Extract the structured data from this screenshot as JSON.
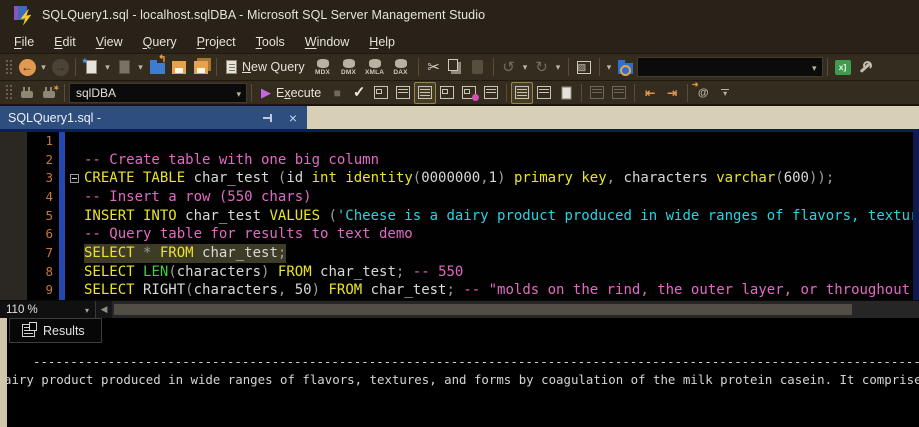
{
  "window": {
    "title": "SQLQuery1.sql - localhost.sqlDBA - Microsoft SQL Server Management Studio"
  },
  "menu": {
    "items": [
      {
        "label": "File",
        "u": 0
      },
      {
        "label": "Edit",
        "u": 0
      },
      {
        "label": "View",
        "u": 0
      },
      {
        "label": "Query",
        "u": 0
      },
      {
        "label": "Project",
        "u": 0
      },
      {
        "label": "Tools",
        "u": 0
      },
      {
        "label": "Window",
        "u": 0
      },
      {
        "label": "Help",
        "u": 0
      }
    ]
  },
  "toolbar_standard": {
    "new_query": {
      "label": "New Query",
      "u": 0
    },
    "query_type_buttons": [
      "MDX",
      "DMX",
      "XMLA",
      "DAX"
    ],
    "search_combo_value": ""
  },
  "toolbar_sql": {
    "database_combo_value": "sqlDBA",
    "execute": {
      "label": "Execute",
      "u": 1
    }
  },
  "document_tab": {
    "label": "SQLQuery1.sql -"
  },
  "editor": {
    "zoom_level": "110 %",
    "lines": [
      {
        "num": "1",
        "segments": []
      },
      {
        "num": "2",
        "segments": [
          {
            "c": "cm",
            "t": "-- Create table with one big column"
          }
        ]
      },
      {
        "num": "3",
        "fold": "minus",
        "segments": [
          {
            "c": "kw",
            "t": "CREATE TABLE"
          },
          {
            "c": "pl",
            "t": " char_test "
          },
          {
            "c": "gr",
            "t": "("
          },
          {
            "c": "pl",
            "t": "id "
          },
          {
            "c": "kw",
            "t": "int identity"
          },
          {
            "c": "gr",
            "t": "("
          },
          {
            "c": "pl",
            "t": "0000000"
          },
          {
            "c": "gr",
            "t": ","
          },
          {
            "c": "pl",
            "t": "1"
          },
          {
            "c": "gr",
            "t": ") "
          },
          {
            "c": "kw",
            "t": "primary key"
          },
          {
            "c": "gr",
            "t": ", "
          },
          {
            "c": "pl",
            "t": "characters "
          },
          {
            "c": "kw",
            "t": "varchar"
          },
          {
            "c": "gr",
            "t": "("
          },
          {
            "c": "pl",
            "t": "600"
          },
          {
            "c": "gr",
            "t": "));"
          }
        ]
      },
      {
        "num": "4",
        "segments": [
          {
            "c": "cm",
            "t": "-- Insert a row (550 chars)"
          }
        ]
      },
      {
        "num": "5",
        "segments": [
          {
            "c": "kw",
            "t": "INSERT INTO"
          },
          {
            "c": "pl",
            "t": " char_test "
          },
          {
            "c": "kw",
            "t": "VALUES"
          },
          {
            "c": "gr",
            "t": " ("
          },
          {
            "c": "str",
            "t": "'Cheese is a dairy product produced in wide ranges of flavors, textures, and"
          }
        ]
      },
      {
        "num": "6",
        "segments": [
          {
            "c": "cm",
            "t": "-- Query table for results to text demo"
          }
        ]
      },
      {
        "num": "7",
        "sel": true,
        "segments": [
          {
            "c": "kw",
            "t": "SELECT"
          },
          {
            "c": "gr",
            "t": " * "
          },
          {
            "c": "kw",
            "t": "FROM"
          },
          {
            "c": "pl",
            "t": " char_test"
          },
          {
            "c": "gr",
            "t": ";"
          }
        ]
      },
      {
        "num": "8",
        "segments": [
          {
            "c": "kw",
            "t": "SELECT"
          },
          {
            "c": "pl",
            "t": " "
          },
          {
            "c": "fn",
            "t": "LEN"
          },
          {
            "c": "gr",
            "t": "("
          },
          {
            "c": "pl",
            "t": "characters"
          },
          {
            "c": "gr",
            "t": ") "
          },
          {
            "c": "kw",
            "t": "FROM"
          },
          {
            "c": "pl",
            "t": " char_test"
          },
          {
            "c": "gr",
            "t": "; "
          },
          {
            "c": "cm",
            "t": "-- 550"
          }
        ]
      },
      {
        "num": "9",
        "segments": [
          {
            "c": "kw",
            "t": "SELECT"
          },
          {
            "c": "pl",
            "t": " RIGHT"
          },
          {
            "c": "gr",
            "t": "("
          },
          {
            "c": "pl",
            "t": "characters"
          },
          {
            "c": "gr",
            "t": ", "
          },
          {
            "c": "pl",
            "t": "50"
          },
          {
            "c": "gr",
            "t": ") "
          },
          {
            "c": "kw",
            "t": "FROM"
          },
          {
            "c": "pl",
            "t": " char_test"
          },
          {
            "c": "gr",
            "t": "; "
          },
          {
            "c": "cm",
            "t": "-- \"molds on the rind, the outer layer, or throughout.\""
          }
        ]
      }
    ]
  },
  "results": {
    "tab_label": "Results",
    "separator_row": "----------------------------------------------------------------------------------------------------------------------------------",
    "value_row": "airy product produced in wide ranges of flavors, textures, and forms by coagulation of the milk protein casein. It comprise"
  },
  "colors": {
    "titlebar_bg": "#292218",
    "toolbar_bg": "#352c20",
    "tab_well": "#d7cfb6",
    "active_tab": "#2d4e7e",
    "tab_border": "#0a1d5e",
    "editor_bg": "#010101",
    "line_number": "#c8793a",
    "keyword": "#ece428",
    "comment": "#e469c5",
    "string": "#2bd2e2",
    "function": "#3ecf3e",
    "selection": "#3e3b26",
    "execute_play": "#c468e0",
    "save_orange": "#e8a24c"
  }
}
